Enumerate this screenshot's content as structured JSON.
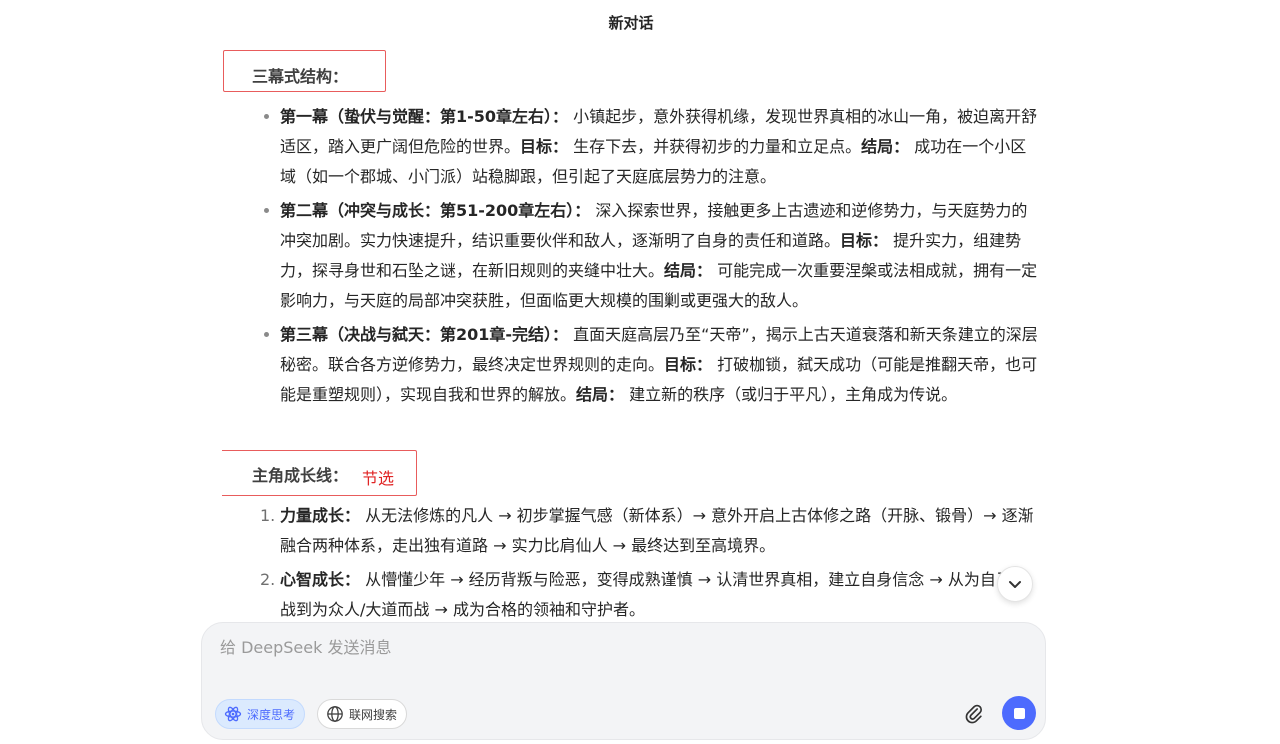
{
  "header": {
    "title": "新对话"
  },
  "sections": {
    "structure_title": "三幕式结构：",
    "growth_title": "主角成长线：",
    "growth_annotation": "节选"
  },
  "acts": [
    {
      "heading": "第一幕（蛰伏与觉醒：第1-50章左右）：",
      "desc": " 小镇起步，意外获得机缘，发现世界真相的冰山一角，被迫离开舒适区，踏入更广阔但危险的世界。",
      "goal_label": "目标：",
      "goal": " 生存下去，并获得初步的力量和立足点。",
      "result_label": "结局：",
      "result": " 成功在一个小区域（如一个郡城、小门派）站稳脚跟，但引起了天庭底层势力的注意。"
    },
    {
      "heading": "第二幕（冲突与成长：第51-200章左右）：",
      "desc": " 深入探索世界，接触更多上古遗迹和逆修势力，与天庭势力的冲突加剧。实力快速提升，结识重要伙伴和敌人，逐渐明了自身的责任和道路。",
      "goal_label": "目标：",
      "goal": " 提升实力，组建势力，探寻身世和石坠之谜，在新旧规则的夹缝中壮大。",
      "result_label": "结局：",
      "result": " 可能完成一次重要涅槃或法相成就，拥有一定影响力，与天庭的局部冲突获胜，但面临更大规模的围剿或更强大的敌人。"
    },
    {
      "heading": "第三幕（决战与弑天：第201章-完结）：",
      "desc": " 直面天庭高层乃至“天帝”，揭示上古天道衰落和新天条建立的深层秘密。联合各方逆修势力，最终决定世界规则的走向。",
      "goal_label": "目标：",
      "goal": " 打破枷锁，弑天成功（可能是推翻天帝，也可能是重塑规则），实现自我和世界的解放。",
      "result_label": "结局：",
      "result": " 建立新的秩序（或归于平凡），主角成为传说。"
    }
  ],
  "growth": [
    {
      "num": "1.",
      "label": "力量成长：",
      "text": " 从无法修炼的凡人 → 初步掌握气感（新体系）→ 意外开启上古体修之路（开脉、锻骨）→ 逐渐融合两种体系，走出独有道路 → 实力比肩仙人 → 最终达到至高境界。"
    },
    {
      "num": "2.",
      "label": "心智成长：",
      "text": " 从懵懂少年 → 经历背叛与险恶，变得成熟谨慎 → 认清世界真相，建立自身信念 → 从为自己而战到为众人/大道而战 → 成为合格的领袖和守护者。"
    }
  ],
  "composer": {
    "placeholder": "给 DeepSeek 发送消息",
    "deep_think_label": "深度思考",
    "web_search_label": "联网搜索"
  },
  "colors": {
    "accent": "#4d6bfe",
    "highlight_border": "#e85c5c",
    "annotation": "#e02424"
  }
}
